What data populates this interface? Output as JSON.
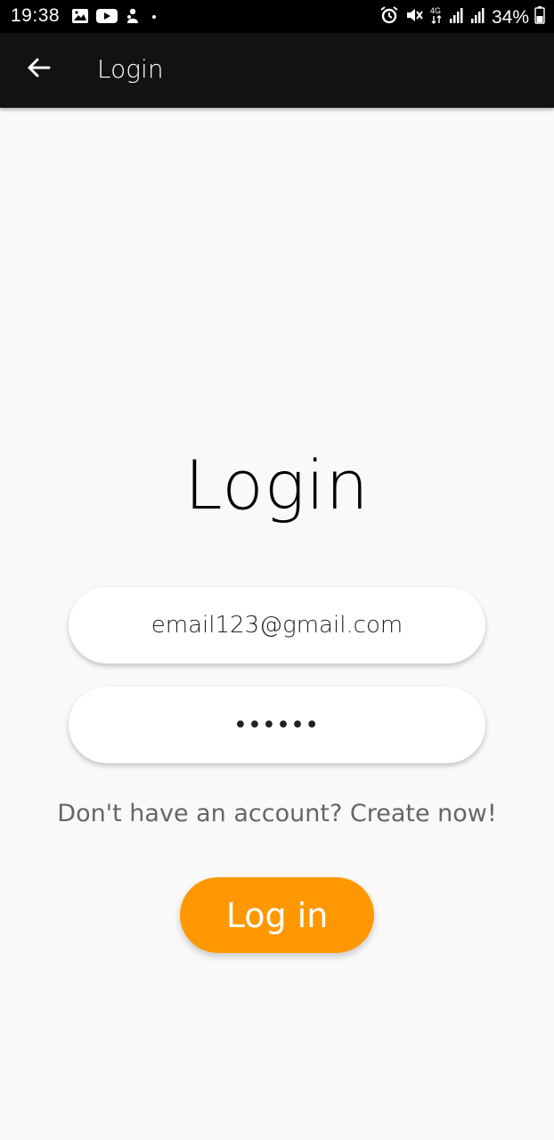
{
  "status_bar": {
    "time": "19:38",
    "battery": "34%",
    "network_label": "4G",
    "left_icons": [
      "image-icon",
      "youtube-icon",
      "notification-icon",
      "dot-icon"
    ],
    "right_icons": [
      "alarm-icon",
      "mute-icon",
      "4g-icon",
      "signal-icon",
      "signal-icon",
      "battery-icon"
    ]
  },
  "toolbar": {
    "title": "Login",
    "back_icon": "arrow-left-icon"
  },
  "main": {
    "heading": "Login",
    "email_value": "email123@gmail.com",
    "password_value": "••••••",
    "signup_text": "Don't have an account? Create now!",
    "login_button": "Log in"
  },
  "colors": {
    "accent": "#ff9800",
    "toolbar": "#121212",
    "background": "#f9f9f9"
  }
}
